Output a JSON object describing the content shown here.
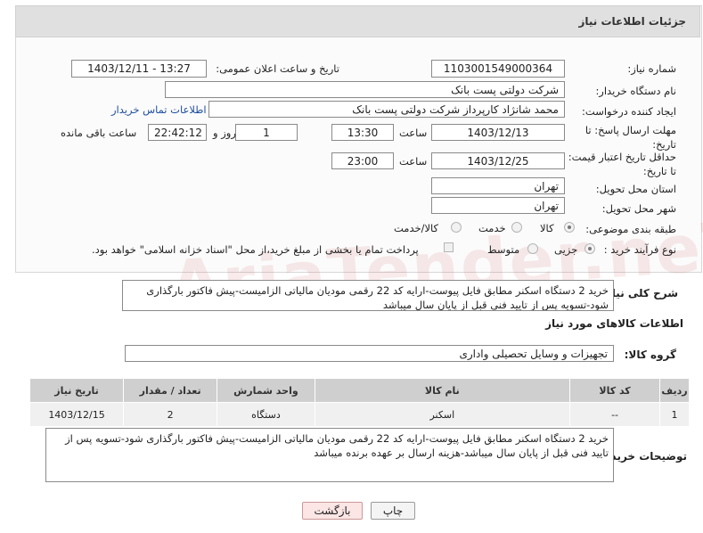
{
  "header": {
    "title": "جزئیات اطلاعات نیاز"
  },
  "fields": {
    "need_number_label": "شماره نیاز:",
    "need_number": "1103001549000364",
    "announce_label": "تاریخ و ساعت اعلان عمومی:",
    "announce_value": "1403/12/11 - 13:27",
    "buyer_label": "نام دستگاه خریدار:",
    "buyer_value": "شرکت دولتی پست بانک",
    "creator_label": "ایجاد کننده درخواست:",
    "creator_value": "محمد شانژاد کارپرداز شرکت دولتی پست بانک",
    "contact_link": "اطلاعات تماس خریدار",
    "deadline_label": "مهلت ارسال پاسخ: تا تاریخ:",
    "deadline_date": "1403/12/13",
    "time_label": "ساعت",
    "deadline_time": "13:30",
    "days_value": "1",
    "days_label": "روز و",
    "remaining_time": "22:42:12",
    "remaining_label": "ساعت باقی مانده",
    "validity_label": "حداقل تاریخ اعتبار قیمت: تا تاریخ:",
    "validity_date": "1403/12/25",
    "validity_time": "23:00",
    "province_label": "استان محل تحویل:",
    "province_value": "تهران",
    "city_label": "شهر محل تحویل:",
    "city_value": "تهران",
    "category_label": "طبقه بندی موضوعی:",
    "category_options": [
      "کالا",
      "خدمت",
      "کالا/خدمت"
    ],
    "process_label": "نوع فرآیند خرید :",
    "process_options": [
      "جزیی",
      "متوسط"
    ],
    "payment_note": "پرداخت تمام یا بخشی از مبلغ خرید،از محل \"اسناد خزانه اسلامی\" خواهد بود."
  },
  "summary": {
    "label": "شرح کلی نیاز:",
    "text": "خرید 2 دستگاه اسکنر مطابق فایل پیوست-ارایه کد 22 رقمی مودیان مالیاتی الزامیست-پیش فاکتور بارگذاری شود-تسویه پس از تایید فنی قبل از پایان سال میباشد"
  },
  "goods": {
    "section_title": "اطلاعات کالاهای مورد نیاز",
    "group_label": "گروه کالا:",
    "group_value": "تجهیزات و وسایل تحصیلی واداری",
    "columns": [
      "ردیف",
      "کد کالا",
      "نام کالا",
      "واحد شمارش",
      "تعداد / مقدار",
      "تاریخ نیاز"
    ],
    "rows": [
      [
        "1",
        "--",
        "اسکنر",
        "دستگاه",
        "2",
        "1403/12/15"
      ]
    ]
  },
  "buyer_notes": {
    "label": "توضیحات خریدار:",
    "text": "خرید 2 دستگاه اسکنر مطابق فایل پیوست-ارایه کد 22 رقمی مودیان مالیاتی الزامیست-پیش فاکتور بارگذاری شود-تسویه پس از تایید فنی قبل از پایان سال میباشد-هزینه ارسال بر عهده برنده میباشد"
  },
  "buttons": {
    "print": "چاپ",
    "back": "بازگشت"
  },
  "watermark": "AriaTender.neT"
}
